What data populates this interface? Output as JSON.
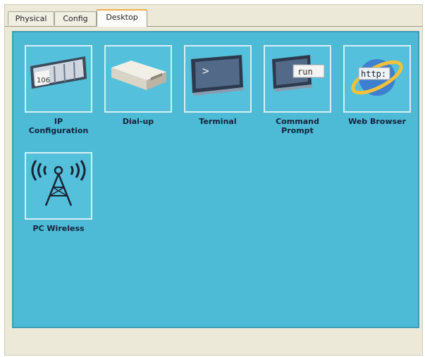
{
  "tabs": [
    {
      "label": "Physical"
    },
    {
      "label": "Config"
    },
    {
      "label": "Desktop"
    }
  ],
  "apps": [
    {
      "label": "IP\nConfiguration",
      "icon": "ip-configuration-icon",
      "icon_text": "106"
    },
    {
      "label": "Dial-up",
      "icon": "dialup-modem-icon"
    },
    {
      "label": "Terminal",
      "icon": "terminal-icon",
      "icon_text": ">"
    },
    {
      "label": "Command\nPrompt",
      "icon": "command-prompt-icon",
      "icon_text": "run"
    },
    {
      "label": "Web Browser",
      "icon": "web-browser-icon",
      "icon_text": "http:"
    },
    {
      "label": "PC Wireless",
      "icon": "wireless-tower-icon"
    }
  ],
  "colors": {
    "desktop_bg": "#4dbad6",
    "window_bg": "#ece9d8",
    "active_tab_accent": "#f0b04a"
  }
}
